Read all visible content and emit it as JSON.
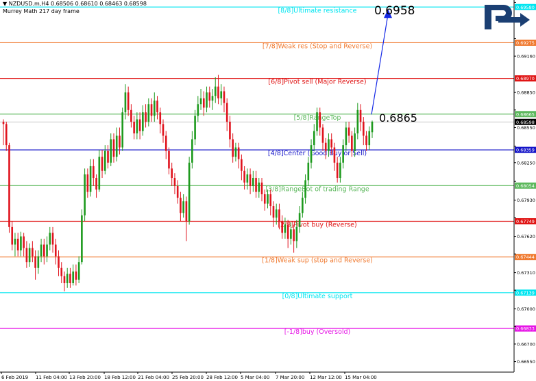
{
  "header": {
    "symbol_line": "NZDUSD.m,H4  0.68506 0.68610 0.68463 0.68598",
    "indicator": "Murrey Math 217 day frame"
  },
  "annotations": {
    "target_price": "0.6958",
    "current_price": "0.6865"
  },
  "colors": {
    "bull": "#1e9a1e",
    "bear": "#e0141e",
    "arrow": "#1428e6"
  },
  "chart_data": {
    "type": "candlestick",
    "ylim": [
      0.6646,
      0.6964
    ],
    "y_ticks": [
      0.6962,
      0.6931,
      0.6916,
      0.6885,
      0.687,
      0.6855,
      0.6839,
      0.6825,
      0.6809,
      0.6793,
      0.6778,
      0.6762,
      0.6747,
      0.6731,
      0.6716,
      0.67,
      0.6685,
      0.667,
      0.6655
    ],
    "y_tick_labels": [
      "0.69620",
      "0.69310",
      "0.69160",
      "0.68850",
      "0.68700",
      "0.68550",
      "0.68390",
      "0.68250",
      "0.68090",
      "0.67930",
      "0.67780",
      "0.67620",
      "0.67470",
      "0.67310",
      "0.67160",
      "0.67000",
      "0.66850",
      "0.66700",
      "0.66550"
    ],
    "x_labels": [
      "6 Feb 2019",
      "11 Feb 04:00",
      "13 Feb 20:00",
      "18 Feb 12:00",
      "21 Feb 04:00",
      "25 Feb 20:00",
      "28 Feb 12:00",
      "5 Mar 04:00",
      "7 Mar 20:00",
      "12 Mar 12:00",
      "15 Mar 04:00"
    ],
    "murrey_levels": [
      {
        "label": "[8/8]Ultimate resistance",
        "value": 0.6958,
        "price_label": "0.69580",
        "color": "#00e5f0"
      },
      {
        "label": "[7/8]Weak res (Stop and Reverse)",
        "value": 0.69275,
        "price_label": "0.69275",
        "color": "#f07a30"
      },
      {
        "label": "[6/8]Pivot sell (Major Reverse)",
        "value": 0.6897,
        "price_label": "0.68970",
        "color": "#e01414"
      },
      {
        "label": "[5/8]RangeTop",
        "value": 0.68665,
        "price_label": "0.68665",
        "color": "#5cb85c"
      },
      {
        "label": "[4/8]Center (Good Buy or Sell)",
        "value": 0.68359,
        "price_label": "0.68359",
        "color": "#1414c8"
      },
      {
        "label": "[3/8]RangeBot of trading Range",
        "value": 0.68054,
        "price_label": "0.68054",
        "color": "#5cb85c"
      },
      {
        "label": "[2/8]Pivot buy (Reverse)",
        "value": 0.67749,
        "price_label": "0.67749",
        "color": "#e01414"
      },
      {
        "label": "[1/8]Weak sup (stop and Reverse)",
        "value": 0.67444,
        "price_label": "0.67444",
        "color": "#f07a30"
      },
      {
        "label": "[0/8]Ultimate support",
        "value": 0.67139,
        "price_label": "0.67139",
        "color": "#00e5f0"
      },
      {
        "label": "[-1/8]buy (Oversold)",
        "value": 0.66833,
        "price_label": "0.66833",
        "color": "#e614e6"
      }
    ],
    "current_price": {
      "value": 0.68598,
      "label": "0.68598"
    },
    "forecast": {
      "from": 0.6865,
      "to": 0.6958
    },
    "candles": [
      [
        0.686,
        0.6858,
        0.6862,
        0.684
      ],
      [
        0.6858,
        0.684,
        0.686,
        0.6835
      ],
      [
        0.684,
        0.677,
        0.6842,
        0.6765
      ],
      [
        0.677,
        0.6755,
        0.6775,
        0.675
      ],
      [
        0.6755,
        0.676,
        0.6765,
        0.6745
      ],
      [
        0.676,
        0.675,
        0.6765,
        0.6745
      ],
      [
        0.675,
        0.6762,
        0.6766,
        0.6745
      ],
      [
        0.6762,
        0.6752,
        0.6765,
        0.6745
      ],
      [
        0.6752,
        0.674,
        0.6758,
        0.6735
      ],
      [
        0.674,
        0.6752,
        0.6756,
        0.6736
      ],
      [
        0.6752,
        0.6745,
        0.6758,
        0.674
      ],
      [
        0.6745,
        0.6735,
        0.675,
        0.6725
      ],
      [
        0.6735,
        0.6745,
        0.675,
        0.673
      ],
      [
        0.6745,
        0.6755,
        0.676,
        0.674
      ],
      [
        0.6755,
        0.6745,
        0.676,
        0.6738
      ],
      [
        0.6745,
        0.6755,
        0.6762,
        0.674
      ],
      [
        0.6755,
        0.6765,
        0.677,
        0.675
      ],
      [
        0.6765,
        0.6755,
        0.677,
        0.6748
      ],
      [
        0.6755,
        0.6745,
        0.676,
        0.6738
      ],
      [
        0.6745,
        0.6735,
        0.675,
        0.6728
      ],
      [
        0.6735,
        0.6728,
        0.674,
        0.6722
      ],
      [
        0.6728,
        0.6722,
        0.6732,
        0.6715
      ],
      [
        0.6722,
        0.673,
        0.6735,
        0.6718
      ],
      [
        0.673,
        0.6722,
        0.6735,
        0.6718
      ],
      [
        0.6722,
        0.6732,
        0.6738,
        0.672
      ],
      [
        0.6732,
        0.6725,
        0.6738,
        0.672
      ],
      [
        0.6725,
        0.674,
        0.6745,
        0.6722
      ],
      [
        0.674,
        0.678,
        0.6785,
        0.6738
      ],
      [
        0.678,
        0.6815,
        0.682,
        0.6775
      ],
      [
        0.6815,
        0.68,
        0.682,
        0.6795
      ],
      [
        0.68,
        0.6822,
        0.6828,
        0.6796
      ],
      [
        0.6822,
        0.6812,
        0.6828,
        0.6805
      ],
      [
        0.6812,
        0.6802,
        0.6815,
        0.6795
      ],
      [
        0.6802,
        0.683,
        0.6836,
        0.68
      ],
      [
        0.683,
        0.6818,
        0.6836,
        0.6812
      ],
      [
        0.6818,
        0.6835,
        0.684,
        0.6815
      ],
      [
        0.6835,
        0.6825,
        0.684,
        0.682
      ],
      [
        0.6825,
        0.6845,
        0.685,
        0.6822
      ],
      [
        0.6845,
        0.683,
        0.685,
        0.6825
      ],
      [
        0.683,
        0.6848,
        0.6855,
        0.6826
      ],
      [
        0.6848,
        0.6838,
        0.6855,
        0.6832
      ],
      [
        0.6838,
        0.6868,
        0.6872,
        0.6835
      ],
      [
        0.6868,
        0.6885,
        0.6892,
        0.6862
      ],
      [
        0.6885,
        0.687,
        0.689,
        0.6865
      ],
      [
        0.687,
        0.686,
        0.6875,
        0.6855
      ],
      [
        0.686,
        0.685,
        0.6865,
        0.6845
      ],
      [
        0.685,
        0.6862,
        0.6868,
        0.6845
      ],
      [
        0.6862,
        0.6852,
        0.6868,
        0.6845
      ],
      [
        0.6852,
        0.6868,
        0.6874,
        0.6848
      ],
      [
        0.6868,
        0.686,
        0.6875,
        0.6855
      ],
      [
        0.686,
        0.6875,
        0.688,
        0.6856
      ],
      [
        0.6875,
        0.6865,
        0.688,
        0.686
      ],
      [
        0.6865,
        0.6878,
        0.6885,
        0.686
      ],
      [
        0.6878,
        0.6868,
        0.6882,
        0.6862
      ],
      [
        0.6868,
        0.6858,
        0.6872,
        0.685
      ],
      [
        0.6858,
        0.6848,
        0.6862,
        0.6842
      ],
      [
        0.6848,
        0.6835,
        0.6852,
        0.6828
      ],
      [
        0.6835,
        0.682,
        0.6838,
        0.6815
      ],
      [
        0.682,
        0.6812,
        0.6825,
        0.6805
      ],
      [
        0.6812,
        0.6805,
        0.6816,
        0.6798
      ],
      [
        0.6805,
        0.6795,
        0.681,
        0.679
      ],
      [
        0.6795,
        0.6782,
        0.68,
        0.6775
      ],
      [
        0.6782,
        0.6792,
        0.6798,
        0.6778
      ],
      [
        0.6792,
        0.6775,
        0.6796,
        0.6758
      ],
      [
        0.6775,
        0.6825,
        0.683,
        0.6772
      ],
      [
        0.6825,
        0.6845,
        0.6852,
        0.682
      ],
      [
        0.6845,
        0.6865,
        0.687,
        0.684
      ],
      [
        0.6865,
        0.6875,
        0.6882,
        0.686
      ],
      [
        0.6875,
        0.688,
        0.6888,
        0.687
      ],
      [
        0.688,
        0.6872,
        0.6886,
        0.6865
      ],
      [
        0.6872,
        0.6885,
        0.689,
        0.6868
      ],
      [
        0.6885,
        0.6878,
        0.689,
        0.6872
      ],
      [
        0.6878,
        0.6882,
        0.6888,
        0.687
      ],
      [
        0.6882,
        0.689,
        0.6898,
        0.6876
      ],
      [
        0.689,
        0.688,
        0.69,
        0.6875
      ],
      [
        0.688,
        0.6886,
        0.6892,
        0.6874
      ],
      [
        0.6886,
        0.6876,
        0.689,
        0.6868
      ],
      [
        0.6876,
        0.686,
        0.688,
        0.6852
      ],
      [
        0.686,
        0.6845,
        0.6865,
        0.6838
      ],
      [
        0.6845,
        0.683,
        0.685,
        0.6825
      ],
      [
        0.683,
        0.6838,
        0.6842,
        0.6826
      ],
      [
        0.6838,
        0.6828,
        0.6842,
        0.682
      ],
      [
        0.6828,
        0.6818,
        0.6832,
        0.681
      ],
      [
        0.6818,
        0.6808,
        0.6822,
        0.6802
      ],
      [
        0.6808,
        0.6815,
        0.682,
        0.6802
      ],
      [
        0.6815,
        0.6805,
        0.682,
        0.6798
      ],
      [
        0.6805,
        0.6812,
        0.6818,
        0.68
      ],
      [
        0.6812,
        0.68,
        0.6818,
        0.6795
      ],
      [
        0.68,
        0.6808,
        0.6812,
        0.6795
      ],
      [
        0.6808,
        0.6798,
        0.6812,
        0.6792
      ],
      [
        0.6798,
        0.679,
        0.6802,
        0.6784
      ],
      [
        0.679,
        0.6798,
        0.6802,
        0.6786
      ],
      [
        0.6798,
        0.6788,
        0.6802,
        0.678
      ],
      [
        0.6788,
        0.6778,
        0.6792,
        0.677
      ],
      [
        0.6778,
        0.6785,
        0.679,
        0.6772
      ],
      [
        0.6785,
        0.6775,
        0.679,
        0.6768
      ],
      [
        0.6775,
        0.6765,
        0.678,
        0.676
      ],
      [
        0.6765,
        0.6772,
        0.6778,
        0.676
      ],
      [
        0.6772,
        0.676,
        0.6776,
        0.6752
      ],
      [
        0.676,
        0.6768,
        0.6774,
        0.6755
      ],
      [
        0.6768,
        0.6758,
        0.6772,
        0.6748
      ],
      [
        0.6758,
        0.677,
        0.6776,
        0.6752
      ],
      [
        0.677,
        0.6782,
        0.6788,
        0.6765
      ],
      [
        0.6782,
        0.6795,
        0.68,
        0.6778
      ],
      [
        0.6795,
        0.681,
        0.6815,
        0.679
      ],
      [
        0.681,
        0.6825,
        0.683,
        0.6805
      ],
      [
        0.6825,
        0.684,
        0.6845,
        0.682
      ],
      [
        0.684,
        0.6852,
        0.6858,
        0.6835
      ],
      [
        0.6852,
        0.6868,
        0.6872,
        0.6848
      ],
      [
        0.6868,
        0.6855,
        0.6872,
        0.6848
      ],
      [
        0.6855,
        0.6842,
        0.6858,
        0.6835
      ],
      [
        0.6842,
        0.6835,
        0.6846,
        0.6828
      ],
      [
        0.6835,
        0.6845,
        0.685,
        0.683
      ],
      [
        0.6845,
        0.6838,
        0.685,
        0.6832
      ],
      [
        0.6838,
        0.6825,
        0.6842,
        0.6818
      ],
      [
        0.6825,
        0.6812,
        0.683,
        0.6808
      ],
      [
        0.6812,
        0.6825,
        0.683,
        0.6808
      ],
      [
        0.6825,
        0.684,
        0.6845,
        0.682
      ],
      [
        0.684,
        0.6855,
        0.686,
        0.6835
      ],
      [
        0.6855,
        0.6848,
        0.686,
        0.6842
      ],
      [
        0.6848,
        0.6835,
        0.6852,
        0.683
      ],
      [
        0.6835,
        0.685,
        0.6855,
        0.683
      ],
      [
        0.685,
        0.687,
        0.6876,
        0.6845
      ],
      [
        0.687,
        0.686,
        0.6875,
        0.6852
      ],
      [
        0.686,
        0.6848,
        0.6864,
        0.684
      ],
      [
        0.6848,
        0.684,
        0.6852,
        0.6835
      ],
      [
        0.684,
        0.6852,
        0.6856,
        0.6836
      ],
      [
        0.6851,
        0.686,
        0.6861,
        0.6846
      ]
    ]
  }
}
